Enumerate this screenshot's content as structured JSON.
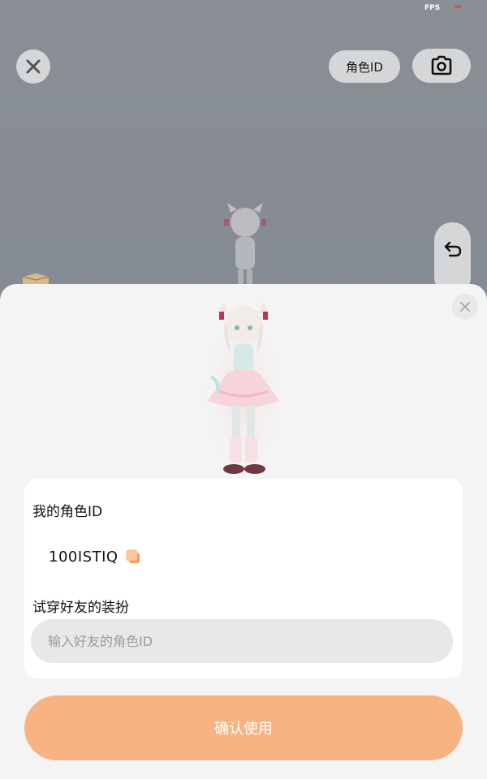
{
  "status": {
    "fps_label": "FPS"
  },
  "toolbar": {
    "role_id_label": "角色ID"
  },
  "icons": {
    "close": "close-icon",
    "camera": "camera-icon",
    "undo": "undo-icon",
    "sheet_close": "close-icon",
    "copy": "copy-icon",
    "box": "box-icon"
  },
  "sheet": {
    "my_id_title": "我的角色ID",
    "my_id_value": "100ISTIQ",
    "try_title": "试穿好友的装扮",
    "friend_input": {
      "value": "",
      "placeholder": "输入好友的角色ID"
    },
    "confirm_label": "确认使用"
  },
  "colors": {
    "background": "#8a8f96",
    "button_bg": "#d4d6d8",
    "sheet_bg": "#f4f4f5",
    "card_bg": "#ffffff",
    "input_bg": "#e8e8e9",
    "confirm_bg": "#f9b383",
    "copy_icon": "#f59a57"
  }
}
